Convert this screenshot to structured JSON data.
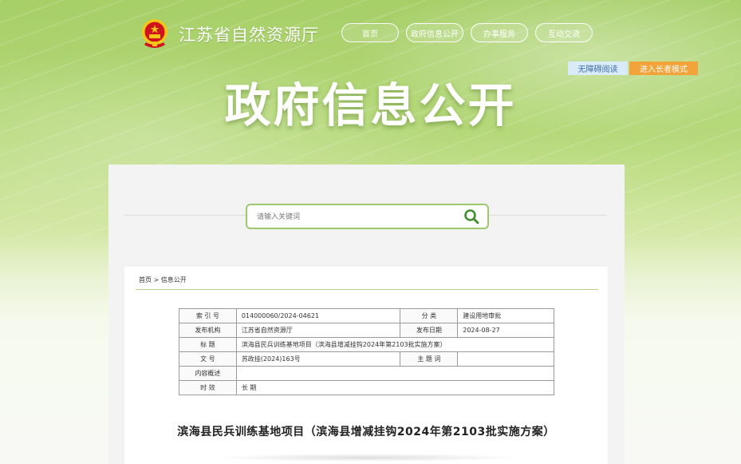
{
  "header": {
    "site_title": "江苏省自然资源厅",
    "nav": [
      "首页",
      "政府信息公开",
      "办事服务",
      "互动交流"
    ],
    "accessibility_label": "无障碍阅读",
    "elder_mode_label": "进入长者模式",
    "banner_title": "政府信息公开"
  },
  "search": {
    "placeholder": "请输入关键词"
  },
  "breadcrumb": {
    "home": "首页",
    "separator": ">",
    "current": "信息公开"
  },
  "meta": {
    "index_label": "索 引 号",
    "index_value": "014000060/2024-04621",
    "category_label": "分 类",
    "category_value": "建设用地审批",
    "publisher_label": "发布机构",
    "publisher_value": "江苏省自然资源厅",
    "date_label": "发布日期",
    "date_value": "2024-08-27",
    "title_label": "标 题",
    "title_value": "滨海县民兵训练基地项目（滨海县增减挂钩2024年第2103批实施方案）",
    "docno_label": "文 号",
    "docno_value": "苏政挂(2024)163号",
    "keywords_label": "主 题 词",
    "keywords_value": "",
    "summary_label": "内容概述",
    "summary_value": "",
    "validity_label": "时 效",
    "validity_value": "长 期"
  },
  "document": {
    "title": "滨海县民兵训练基地项目（滨海县增减挂钩2024年第2103批实施方案）"
  },
  "colors": {
    "accent_green": "#9cc96b",
    "elder_orange": "#f2a33a",
    "access_blue": "#d9eaf9",
    "emblem_red": "#d0121b",
    "emblem_gold": "#f5c518"
  },
  "icons": [
    "national-emblem-icon",
    "search-icon"
  ]
}
